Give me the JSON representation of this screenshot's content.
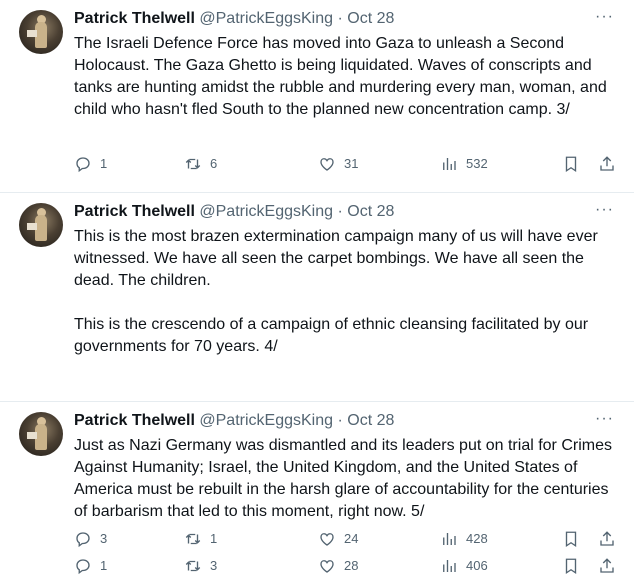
{
  "tweets": [
    {
      "name": "Patrick Thelwell",
      "handle": "@PatrickEggsKing",
      "separator": "·",
      "date": "Oct 28",
      "more": "···",
      "paragraphs": [
        "The Israeli Defence Force has moved into Gaza to unleash a Second Holocaust. The Gaza Ghetto is being liquidated. Waves of conscripts and tanks are hunting amidst the rubble and murdering every man, woman, and child who hasn't fled South to the planned new concentration camp. 3/"
      ],
      "replies": "1",
      "retweets": "6",
      "likes": "31",
      "views": "532"
    },
    {
      "name": "Patrick Thelwell",
      "handle": "@PatrickEggsKing",
      "separator": "·",
      "date": "Oct 28",
      "more": "···",
      "paragraphs": [
        "This is the most brazen extermination campaign many of us will have ever witnessed. We have all seen the carpet bombings. We have all seen the dead. The children.",
        "This is the crescendo of a campaign of ethnic cleansing facilitated by our governments for 70 years. 4/"
      ],
      "replies": "1",
      "retweets": "3",
      "likes": "28",
      "views": "406"
    },
    {
      "name": "Patrick Thelwell",
      "handle": "@PatrickEggsKing",
      "separator": "·",
      "date": "Oct 28",
      "more": "···",
      "paragraphs": [
        "Just as Nazi Germany was dismantled and its leaders put on trial for Crimes Against Humanity; Israel, the United Kingdom, and the United States of America must be rebuilt in the harsh glare of accountability for the centuries of barbarism that led to this moment, right now. 5/"
      ],
      "replies": "3",
      "retweets": "1",
      "likes": "24",
      "views": "428"
    }
  ],
  "icons": {
    "reply": "reply-icon",
    "retweet": "retweet-icon",
    "like": "heart-icon",
    "views": "views-icon",
    "bookmark": "bookmark-icon",
    "share": "share-icon"
  },
  "colors": {
    "text": "#0f1419",
    "muted": "#536471",
    "divider": "#e6ecf0"
  }
}
